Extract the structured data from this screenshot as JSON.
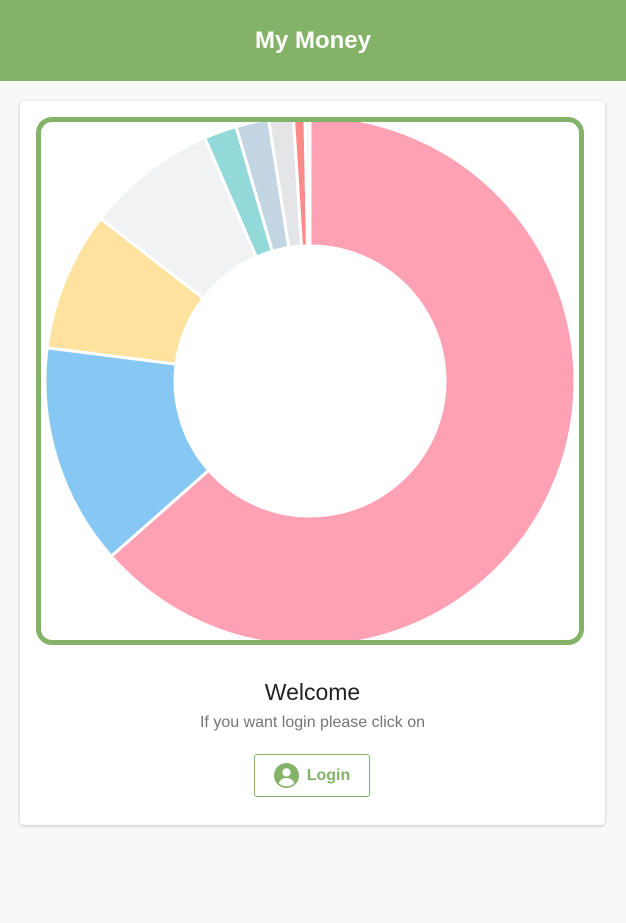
{
  "app_bar": {
    "title": "My Money",
    "color": "#84b269"
  },
  "main": {
    "welcome_title": "Welcome",
    "welcome_subtitle": "If you want login please click on",
    "login_button": {
      "label": "Login",
      "icon": "account-circle-icon"
    }
  },
  "chart_data": {
    "type": "pie",
    "style": "doughnut",
    "values": [
      63.5,
      13.5,
      8.5,
      8.0,
      2.0,
      2.0,
      1.5,
      0.7,
      0.3
    ],
    "colors": [
      "#ffa1b5",
      "#86c7f3",
      "#ffe29d",
      "#f1f2f4",
      "#93d9d9",
      "#c3d5e2",
      "#e4e5e7",
      "#ff8a8a",
      "#f4f4f4"
    ],
    "legend": "none"
  }
}
